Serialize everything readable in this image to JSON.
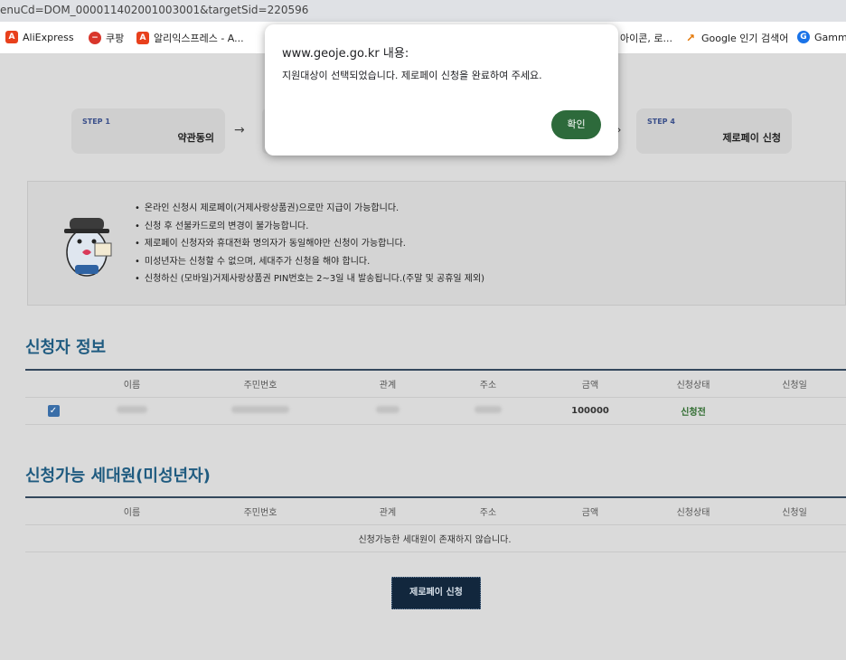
{
  "browser": {
    "url_fragment": "enuCd=DOM_000011402001003001&targetSid=220596",
    "bookmarks": [
      {
        "label": "AliExpress",
        "icon": "aliexpress-icon"
      },
      {
        "label": "쿠팡",
        "icon": "coupang-icon"
      },
      {
        "label": "알리익스프레스 - A...",
        "icon": "aliexpress-icon"
      },
      {
        "label": "아이콘, 로...",
        "icon": "generic-icon"
      },
      {
        "label": "Google 인기 검색어",
        "icon": "trend-icon"
      },
      {
        "label": "Gamma",
        "icon": "gamma-icon"
      }
    ]
  },
  "steps": [
    {
      "no": "STEP 1",
      "title": "약관동의"
    },
    {
      "no": "STEP 4",
      "title": "제로페이 신청"
    }
  ],
  "notice": {
    "items": [
      "온라인 신청시 제로페이(거제사랑상품권)으로만 지급이 가능합니다.",
      "신청 후 선불카드로의 변경이 불가능합니다.",
      "제로페이 신청자와 휴대전화 명의자가 동일해야만 신청이 가능합니다.",
      "미성년자는 신청할 수 없으며, 세대주가 신청을 해야 합니다.",
      "신청하신 (모바일)거제사랑상품권 PIN번호는 2~3일 내 발송됩니다.(주말 및 공휴일 제외)"
    ]
  },
  "applicant": {
    "title": "신청자 정보",
    "headers": [
      "이름",
      "주민번호",
      "관계",
      "주소",
      "금액",
      "신청상태",
      "신청일"
    ],
    "row": {
      "amount": "100000",
      "status": "신청전"
    }
  },
  "household": {
    "title": "신청가능 세대원(미성년자)",
    "headers": [
      "이름",
      "주민번호",
      "관계",
      "주소",
      "금액",
      "신청상태",
      "신청일"
    ],
    "empty_message": "신청가능한 세대원이 존재하지 않습니다."
  },
  "apply_button": "제로페이 신청",
  "dialog": {
    "title": "www.geoje.go.kr 내용:",
    "message": "지원대상이 선택되었습니다. 제로페이 신청을 완료하여 주세요.",
    "ok_label": "확인"
  },
  "colors": {
    "section_title": "#1f5b80",
    "dialog_button": "#2d6a3b",
    "apply_button": "#12273d"
  }
}
